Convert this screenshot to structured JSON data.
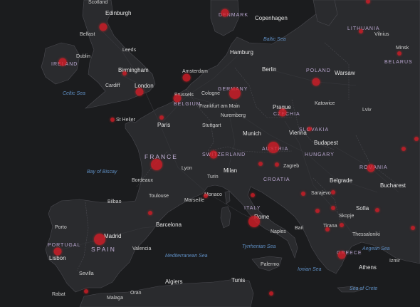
{
  "map": {
    "colors": {
      "water": "#1b1c1e",
      "land": "#2a2b2e",
      "roads": "#3a3b3f",
      "border": "#4a4a50",
      "case_marker": "#da1c26",
      "country_label": "#b9a6cf",
      "city_label": "#cfcfcf",
      "sea_label": "#5f8fc4"
    },
    "countries": [
      {
        "key": "denmark",
        "name": "DENMARK"
      },
      {
        "key": "lithuania",
        "name": "LITHUANIA"
      },
      {
        "key": "belarus",
        "name": "BELARUS"
      },
      {
        "key": "ireland",
        "name": "IRELAND"
      },
      {
        "key": "poland",
        "name": "POLAND"
      },
      {
        "key": "germany",
        "name": "GERMANY"
      },
      {
        "key": "belgium",
        "name": "BELGIUM"
      },
      {
        "key": "czechia",
        "name": "CZECHIA"
      },
      {
        "key": "slovakia",
        "name": "SLOVAKIA"
      },
      {
        "key": "france",
        "name": "FRANCE"
      },
      {
        "key": "austria",
        "name": "AUSTRIA"
      },
      {
        "key": "hungary",
        "name": "HUNGARY"
      },
      {
        "key": "switzerland",
        "name": "SWITZERLAND"
      },
      {
        "key": "romania",
        "name": "ROMANIA"
      },
      {
        "key": "croatia",
        "name": "CROATIA"
      },
      {
        "key": "italy",
        "name": "ITALY"
      },
      {
        "key": "portugal",
        "name": "PORTUGAL"
      },
      {
        "key": "spain",
        "name": "SPAIN"
      },
      {
        "key": "greece",
        "name": "GREECE"
      }
    ],
    "cities": [
      {
        "key": "scotland",
        "name": "Scotland"
      },
      {
        "key": "edinburgh",
        "name": "Edinburgh"
      },
      {
        "key": "copenhagen",
        "name": "Copenhagen"
      },
      {
        "key": "belfast",
        "name": "Belfast"
      },
      {
        "key": "vilnius",
        "name": "Vilnius"
      },
      {
        "key": "dublin",
        "name": "Dublin"
      },
      {
        "key": "leeds",
        "name": "Leeds"
      },
      {
        "key": "hamburg",
        "name": "Hamburg"
      },
      {
        "key": "minsk",
        "name": "Minsk"
      },
      {
        "key": "birmingham",
        "name": "Birmingham"
      },
      {
        "key": "amsterdam",
        "name": "Amsterdam"
      },
      {
        "key": "berlin",
        "name": "Berlin"
      },
      {
        "key": "warsaw",
        "name": "Warsaw"
      },
      {
        "key": "cardiff",
        "name": "Cardiff"
      },
      {
        "key": "london",
        "name": "London"
      },
      {
        "key": "brussels",
        "name": "Brussels"
      },
      {
        "key": "cologne",
        "name": "Cologne"
      },
      {
        "key": "frankfurt",
        "name": "Frankfurt am Main"
      },
      {
        "key": "prague",
        "name": "Prague"
      },
      {
        "key": "katowice",
        "name": "Katowice"
      },
      {
        "key": "lviv",
        "name": "Lviv"
      },
      {
        "key": "sthelier",
        "name": "St Helier"
      },
      {
        "key": "paris",
        "name": "Paris"
      },
      {
        "key": "nuremberg",
        "name": "Nuremberg"
      },
      {
        "key": "stuttgart",
        "name": "Stuttgart"
      },
      {
        "key": "munich",
        "name": "Munich"
      },
      {
        "key": "vienna",
        "name": "Vienna"
      },
      {
        "key": "budapest",
        "name": "Budapest"
      },
      {
        "key": "lyon",
        "name": "Lyon"
      },
      {
        "key": "zagreb",
        "name": "Zagreb"
      },
      {
        "key": "milan",
        "name": "Milan"
      },
      {
        "key": "turin",
        "name": "Turin"
      },
      {
        "key": "bordeaux",
        "name": "Bordeaux"
      },
      {
        "key": "belgrade",
        "name": "Belgrade"
      },
      {
        "key": "bucharest",
        "name": "Bucharest"
      },
      {
        "key": "sarajevo",
        "name": "Sarajevo"
      },
      {
        "key": "toulouse",
        "name": "Toulouse"
      },
      {
        "key": "monaco",
        "name": "Monaco"
      },
      {
        "key": "marseille",
        "name": "Marseille"
      },
      {
        "key": "bilbao",
        "name": "Bilbao"
      },
      {
        "key": "sofia",
        "name": "Sofia"
      },
      {
        "key": "skopje",
        "name": "Skopje"
      },
      {
        "key": "porto",
        "name": "Porto"
      },
      {
        "key": "barcelona",
        "name": "Barcelona"
      },
      {
        "key": "rome",
        "name": "Rome"
      },
      {
        "key": "tirana",
        "name": "Tirana"
      },
      {
        "key": "madrid",
        "name": "Madrid"
      },
      {
        "key": "naples",
        "name": "Naples"
      },
      {
        "key": "bari",
        "name": "Bari"
      },
      {
        "key": "thessaloniki",
        "name": "Thessaloniki"
      },
      {
        "key": "lisbon",
        "name": "Lisbon"
      },
      {
        "key": "valencia",
        "name": "Valencia"
      },
      {
        "key": "athens",
        "name": "Athens"
      },
      {
        "key": "izmir",
        "name": "Izmir"
      },
      {
        "key": "sevilla",
        "name": "Sevilla"
      },
      {
        "key": "palermo",
        "name": "Palermo"
      },
      {
        "key": "algiers",
        "name": "Algiers"
      },
      {
        "key": "tunis",
        "name": "Tunis"
      },
      {
        "key": "malaga",
        "name": "Malaga"
      },
      {
        "key": "oran",
        "name": "Oran"
      },
      {
        "key": "rabat",
        "name": "Rabat"
      }
    ],
    "seas": [
      {
        "key": "baltic",
        "name": "Baltic Sea"
      },
      {
        "key": "celtic",
        "name": "Celtic Sea"
      },
      {
        "key": "biscay",
        "name": "Bay of Biscay"
      },
      {
        "key": "mediterranean",
        "name": "Mediterranean Sea"
      },
      {
        "key": "tyrrhenian",
        "name": "Tyrrhenian Sea"
      },
      {
        "key": "ionian",
        "name": "Ionian Sea"
      },
      {
        "key": "aegean",
        "name": "Aegean Sea"
      },
      {
        "key": "crete",
        "name": "Sea of Crete"
      }
    ],
    "case_markers": [
      {
        "place": "Denmark",
        "size": "medium"
      },
      {
        "place": "Edinburgh",
        "size": "medium"
      },
      {
        "place": "Ireland",
        "size": "medium"
      },
      {
        "place": "Birmingham",
        "size": "small"
      },
      {
        "place": "London",
        "size": "medium"
      },
      {
        "place": "Netherlands",
        "size": "medium"
      },
      {
        "place": "Belgium",
        "size": "medium"
      },
      {
        "place": "Paris",
        "size": "small"
      },
      {
        "place": "Germany",
        "size": "large"
      },
      {
        "place": "Poland",
        "size": "medium"
      },
      {
        "place": "Czechia",
        "size": "medium"
      },
      {
        "place": "Austria",
        "size": "large"
      },
      {
        "place": "Switzerland",
        "size": "medium"
      },
      {
        "place": "France",
        "size": "large"
      },
      {
        "place": "Italy",
        "size": "large"
      },
      {
        "place": "Spain",
        "size": "large"
      },
      {
        "place": "Portugal",
        "size": "medium"
      },
      {
        "place": "Romania",
        "size": "medium"
      },
      {
        "place": "Greece",
        "size": "medium"
      },
      {
        "place": "Croatia",
        "size": "small"
      },
      {
        "place": "Lithuania",
        "size": "small"
      },
      {
        "place": "Belarus",
        "size": "small"
      },
      {
        "place": "Slovakia",
        "size": "small"
      },
      {
        "place": "Serbia",
        "size": "small"
      },
      {
        "place": "Bulgaria",
        "size": "small"
      },
      {
        "place": "Albania",
        "size": "small"
      },
      {
        "place": "North Macedonia",
        "size": "small"
      },
      {
        "place": "Bosnia and Herzegovina",
        "size": "small"
      },
      {
        "place": "Slovenia",
        "size": "small"
      },
      {
        "place": "Monaco",
        "size": "small"
      },
      {
        "place": "Andorra",
        "size": "small"
      },
      {
        "place": "Gibraltar",
        "size": "small"
      },
      {
        "place": "Jersey",
        "size": "small"
      },
      {
        "place": "Malta",
        "size": "small"
      },
      {
        "place": "Moldova",
        "size": "small"
      },
      {
        "place": "Montenegro",
        "size": "small"
      },
      {
        "place": "Kosovo",
        "size": "small"
      },
      {
        "place": "Turkey",
        "size": "small"
      },
      {
        "place": "Latvia",
        "size": "small"
      },
      {
        "place": "San Marino",
        "size": "small"
      },
      {
        "place": "Ukraine",
        "size": "small"
      }
    ]
  }
}
